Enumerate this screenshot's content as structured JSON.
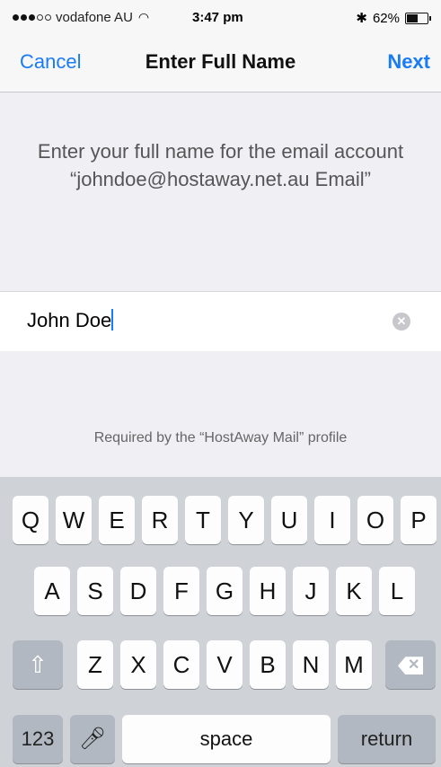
{
  "status": {
    "carrier": "vodafone AU",
    "time": "3:47 pm",
    "bluetooth_icon": "bluetooth-icon",
    "battery_text": "62%",
    "battery_level": 0.62
  },
  "nav": {
    "cancel_label": "Cancel",
    "title": "Enter Full Name",
    "next_label": "Next"
  },
  "info": {
    "text": "Enter your full name for the email account “johndoe@hostaway.net.au Email”"
  },
  "name_field": {
    "value": "John Doe",
    "clear_icon": "clear-icon"
  },
  "footer": {
    "text": "Required by the “HostAway Mail” profile"
  },
  "keyboard": {
    "row1": [
      "Q",
      "W",
      "E",
      "R",
      "T",
      "Y",
      "U",
      "I",
      "O",
      "P"
    ],
    "row2": [
      "A",
      "S",
      "D",
      "F",
      "G",
      "H",
      "J",
      "K",
      "L"
    ],
    "row3": [
      "Z",
      "X",
      "C",
      "V",
      "B",
      "N",
      "M"
    ],
    "numbers_label": "123",
    "space_label": "space",
    "return_label": "return",
    "shift_icon": "shift-icon",
    "backspace_icon": "backspace-icon",
    "mic_icon": "microphone-icon"
  },
  "colors": {
    "accent": "#1a7cf2",
    "panel_bg": "#efeff4",
    "keyboard_bg": "#cfd2d7"
  }
}
